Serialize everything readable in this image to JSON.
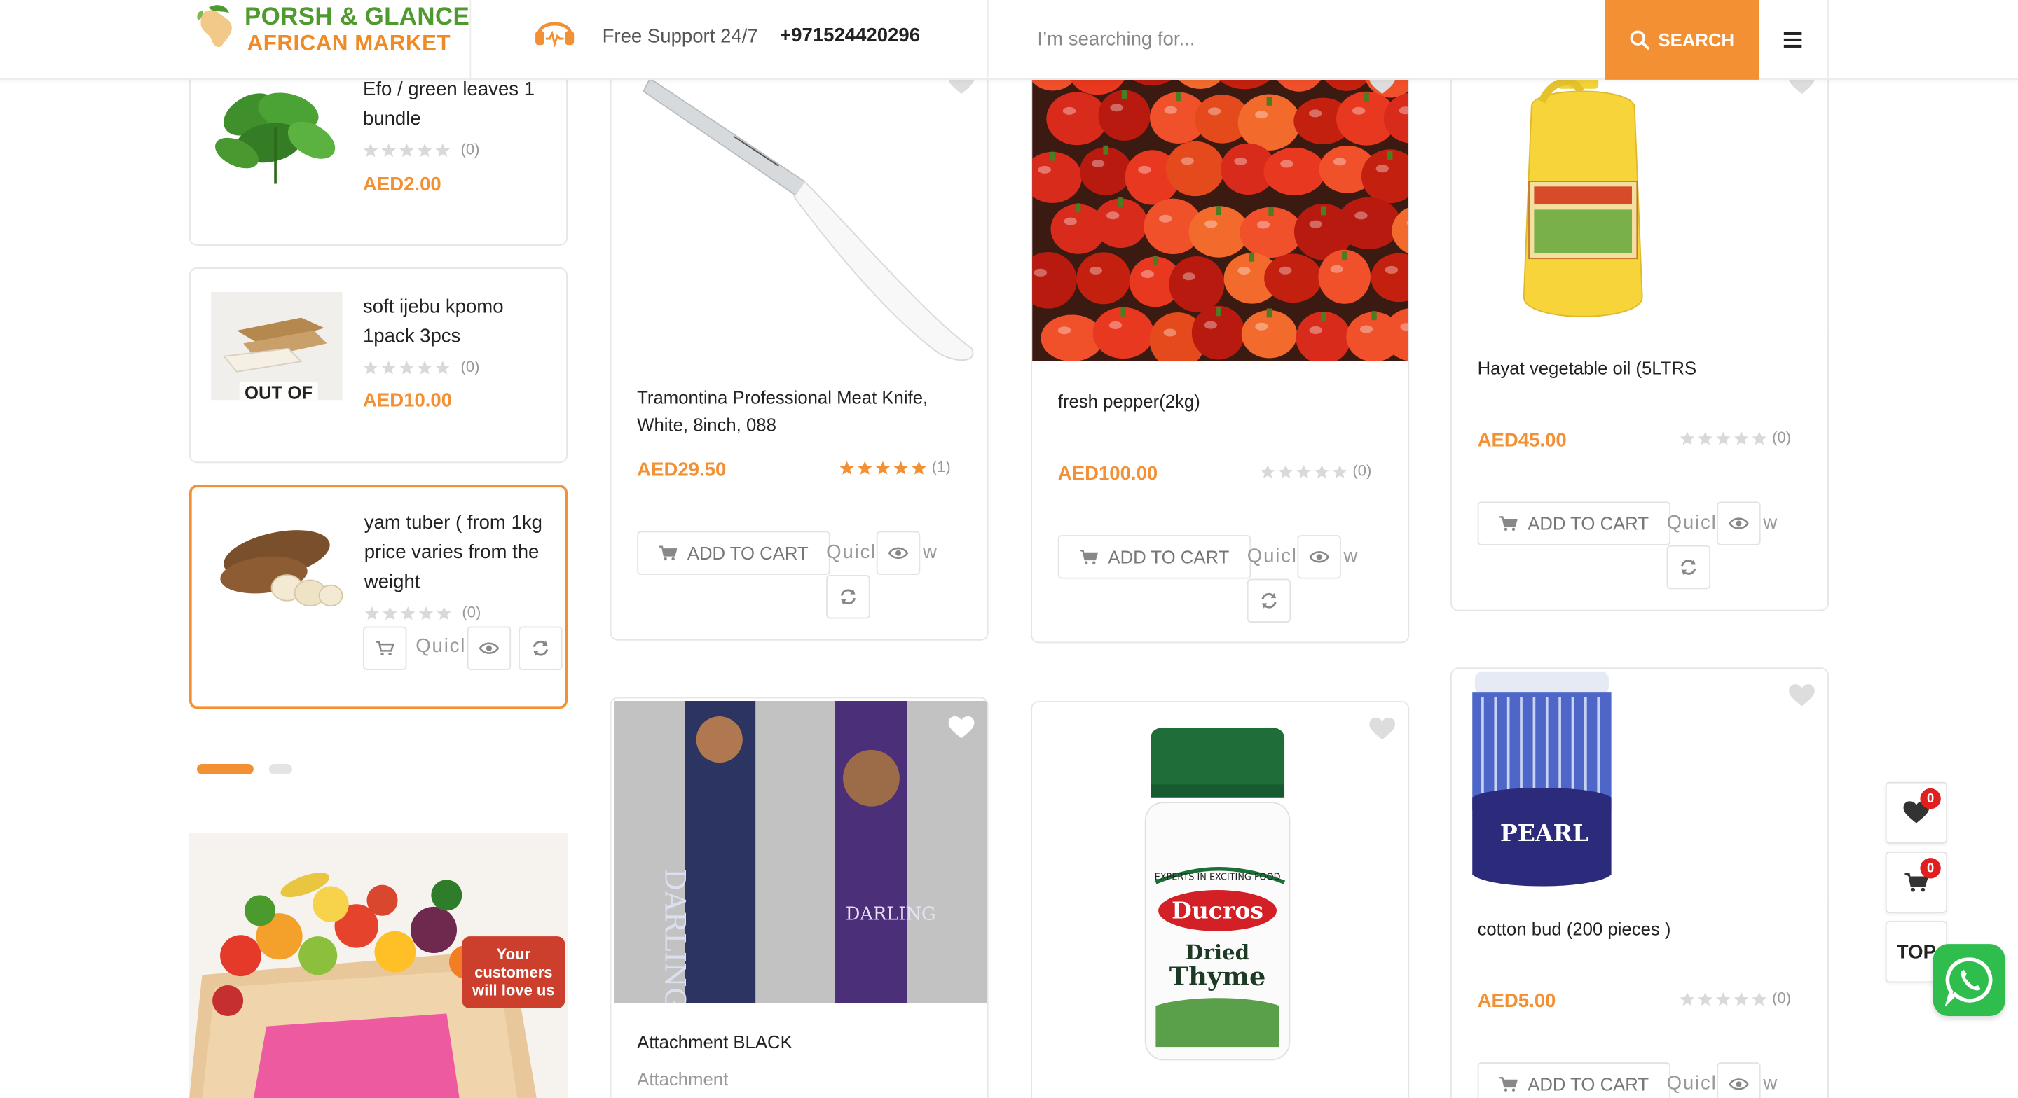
{
  "header": {
    "logo_line1": "PORSH & GLANCE",
    "logo_line2": "AFRICAN MARKET",
    "support_text": "Free Support 24/7",
    "support_phone": "+971524420296",
    "search_placeholder": "I’m searching for...",
    "search_button": "SEARCH",
    "menu_icon": "hamburger-menu-icon"
  },
  "sidebar": {
    "items": [
      {
        "name": "Efo / green leaves 1 bundle",
        "rating_count": "(0)",
        "price": "AED2.00"
      },
      {
        "name": "soft ijebu kpomo 1pack 3pcs",
        "rating_count": "(0)",
        "price": "AED10.00",
        "badge": "OUT OF"
      },
      {
        "name": "yam tuber ( from 1kg price varies from the weight",
        "rating_count": "(0)",
        "quick_text": "Quicl"
      }
    ],
    "slider_dots": 2,
    "banner_text": "Your customers will love us"
  },
  "products": [
    {
      "name": "Tramontina Professional Meat Knife, White, 8inch, 088",
      "price": "AED29.50",
      "rating_count": "(1)",
      "stars": 5,
      "add_label": "ADD TO CART",
      "quick_text": "Quicl",
      "quick_tail": "w"
    },
    {
      "name": "fresh pepper(2kg)",
      "price": "AED100.00",
      "rating_count": "(0)",
      "stars": 0,
      "add_label": "ADD TO CART",
      "quick_text": "Quicl",
      "quick_tail": "w"
    },
    {
      "name": "Hayat vegetable oil (5LTRS",
      "price": "AED45.00",
      "rating_count": "(0)",
      "stars": 0,
      "add_label": "ADD TO CART",
      "quick_text": "Quicl",
      "quick_tail": "w"
    },
    {
      "name": "Attachment BLACK",
      "category": "Attachment"
    },
    {
      "name": "Dried Thyme"
    },
    {
      "name": "cotton bud (200 pieces )",
      "price": "AED5.00",
      "rating_count": "(0)",
      "stars": 0,
      "add_label": "ADD TO CART",
      "quick_text": "Quicl",
      "quick_tail": "w"
    }
  ],
  "floating": {
    "wishlist_count": "0",
    "cart_count": "0",
    "top_label": "TOP"
  },
  "colors": {
    "accent": "#f29033",
    "green": "#4e9a2f",
    "whatsapp": "#2fbd4d",
    "badge_red": "#e02020"
  }
}
